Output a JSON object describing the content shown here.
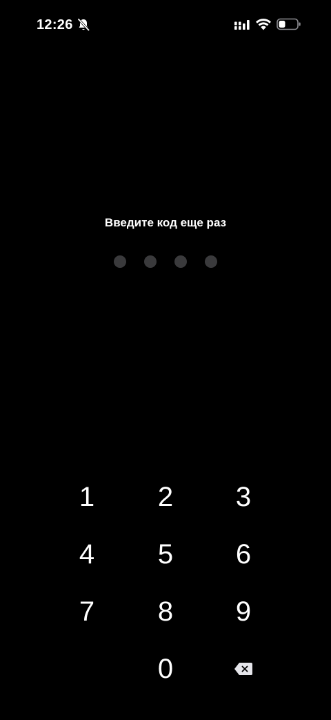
{
  "status_bar": {
    "time": "12:26",
    "icons": [
      "bell-off-icon",
      "signal-icon",
      "wifi-icon",
      "battery-icon"
    ]
  },
  "passcode": {
    "prompt": "Введите код еще раз",
    "digits_total": 4,
    "digits_entered": 0
  },
  "keypad": {
    "keys": [
      "1",
      "2",
      "3",
      "4",
      "5",
      "6",
      "7",
      "8",
      "9",
      "0"
    ],
    "backspace_icon": "backspace-icon"
  },
  "colors": {
    "background": "#000000",
    "text": "#ffffff",
    "dot_empty": "#3a3a3c"
  }
}
